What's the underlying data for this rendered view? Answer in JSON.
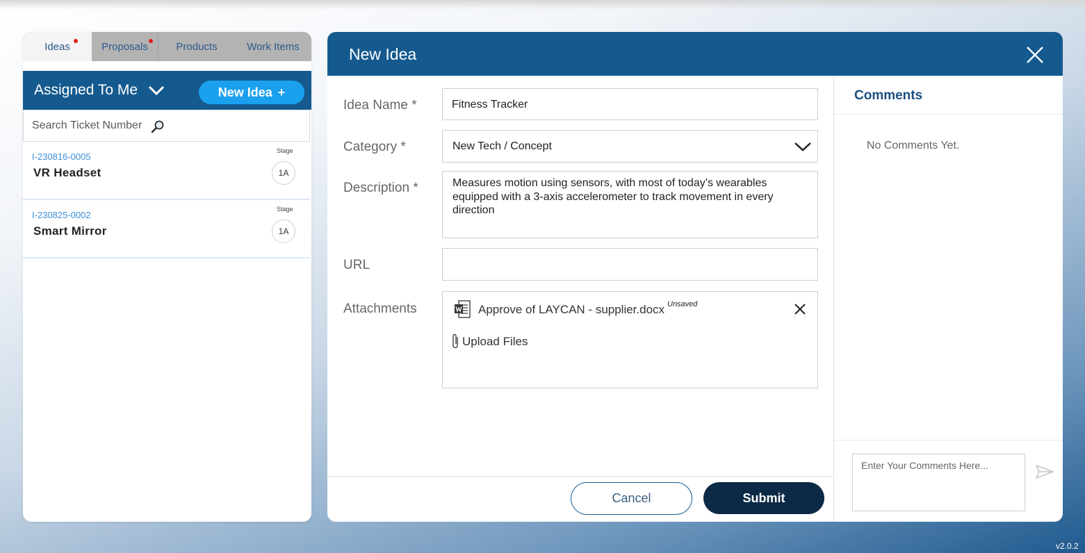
{
  "tabs": [
    {
      "label": "Ideas",
      "notification": true
    },
    {
      "label": "Proposals",
      "notification": true
    },
    {
      "label": "Products",
      "notification": false
    },
    {
      "label": "Work Items",
      "notification": false
    }
  ],
  "sidebar": {
    "filter_label": "Assigned To Me",
    "new_idea_label": "New Idea",
    "new_idea_plus": "+",
    "search_placeholder": "Search Ticket Number",
    "tickets": [
      {
        "id": "I-230816-0005",
        "name": "VR Headset",
        "stage_label": "Stage",
        "stage": "1A"
      },
      {
        "id": "I-230825-0002",
        "name": "Smart Mirror",
        "stage_label": "Stage",
        "stage": "1A"
      }
    ]
  },
  "modal": {
    "title": "New Idea",
    "fields": {
      "idea_name_label": "Idea Name *",
      "idea_name_value": "Fitness Tracker",
      "category_label": "Category *",
      "category_value": "New Tech / Concept",
      "description_label": "Description *",
      "description_value": "Measures motion using sensors, with most of today’s wearables equipped with a 3-axis accelerometer to track movement in every direction",
      "url_label": "URL",
      "url_value": "",
      "attachments_label": "Attachments",
      "attachment_file": "Approve of LAYCAN - supplier.docx",
      "attachment_status": "Unsaved",
      "upload_label": "Upload Files"
    },
    "cancel_label": "Cancel",
    "submit_label": "Submit"
  },
  "comments": {
    "title": "Comments",
    "empty_text": "No Comments Yet.",
    "input_placeholder": "Enter Your Comments Here..."
  },
  "version": "v2.0.2",
  "colors": {
    "primary": "#155a8f",
    "accent_button": "#1aa0ef",
    "submit": "#0c2a45",
    "notification_dot": "#e0201c",
    "link_blue": "#3a8fd8"
  }
}
